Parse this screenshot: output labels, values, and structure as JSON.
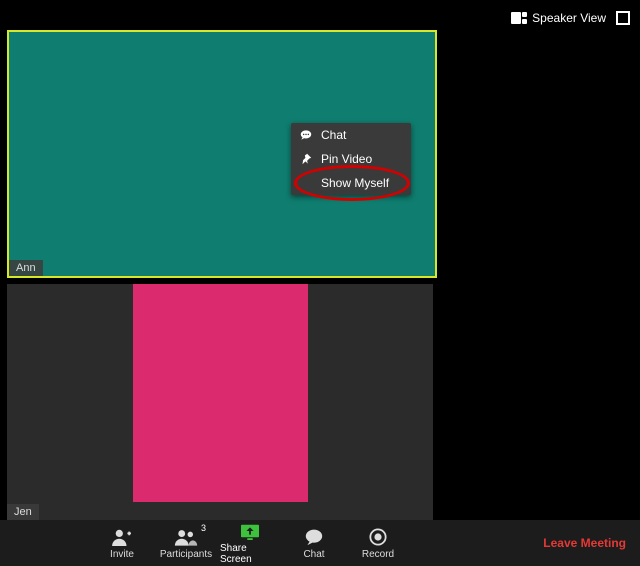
{
  "topbar": {
    "view_label": "Speaker View"
  },
  "tiles": {
    "t1_name": "Ann",
    "t2_name": "Jen"
  },
  "context_menu": {
    "chat": "Chat",
    "pin": "Pin Video",
    "show_self": "Show Myself"
  },
  "toolbar": {
    "invite": "Invite",
    "participants": "Participants",
    "participants_count": "3",
    "share": "Share Screen",
    "chat": "Chat",
    "record": "Record",
    "leave": "Leave Meeting"
  }
}
